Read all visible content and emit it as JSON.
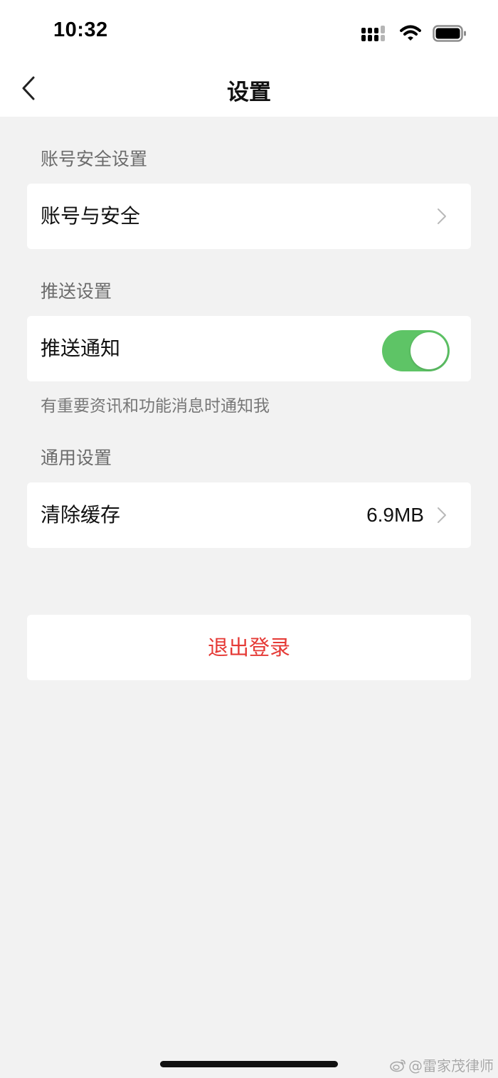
{
  "status_bar": {
    "time": "10:32",
    "icons": [
      "cellular-signal-icon",
      "wifi-icon",
      "battery-icon"
    ]
  },
  "nav": {
    "title": "设置",
    "back_icon": "chevron-left-icon"
  },
  "sections": {
    "account": {
      "title": "账号安全设置",
      "item_label": "账号与安全"
    },
    "push": {
      "title": "推送设置",
      "item_label": "推送通知",
      "toggle_on": true,
      "hint": "有重要资讯和功能消息时通知我"
    },
    "general": {
      "title": "通用设置",
      "item_label": "清除缓存",
      "item_value": "6.9MB"
    }
  },
  "logout_label": "退出登录",
  "watermark": {
    "text": "@雷家茂律师",
    "icon": "weibo-icon"
  },
  "colors": {
    "page_bg": "#f2f2f2",
    "toggle_on": "#5ec466",
    "logout_text": "#e53935"
  }
}
